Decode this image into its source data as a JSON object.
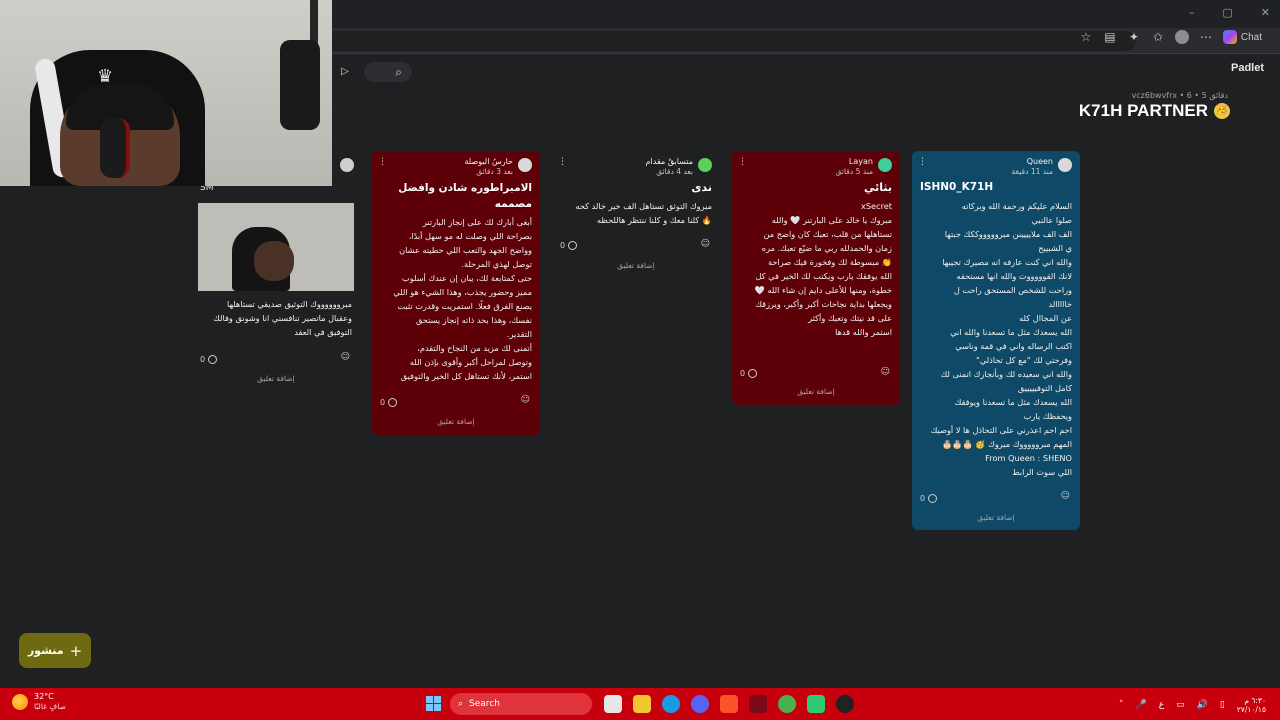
{
  "browser": {
    "window_controls": [
      "–",
      "▢",
      "✕"
    ],
    "chat_label": "Chat"
  },
  "padlet": {
    "logo": "Padlet",
    "board_meta": "vcz6bwvfrx • 6 • 5 دقائق",
    "board_title": "K71H PARTNER",
    "board_emoji": "🥳",
    "post_button_label": "منشور",
    "add_comment_label": "إضافة تعليق"
  },
  "cards": [
    {
      "id": "queen",
      "author": "Queen",
      "time": "منذ 11 دقيقة",
      "title": "ISHN0_K71H",
      "body": "السلام عليكم ورحمة الله وبركاته\nصلوا عالنبي\nالف الف ملايييينن مبروووووككك جبتها\nي الشبييح\nوالله اني كنت عارفه انه مصيرك تجيبها\nلانك القوووووت والله انها مستحقه\nوراحت للشخص المستحق راحت ل\nخااااالد\nعن المجاال كله\nالله يسعدك مثل ما تسعدنا والله اني\nاكتب الرساله واني في قمة وناسي\nوفرحتي لك \"مع كل تحاذلي\"\nوالله اني سعيده لك وبأنجازك اتمنى لك\nكامل التوفيييييق\nالله يسعدك مثل ما تسعدنا ويوفقك\nويحفظك يارب\nاحم احم اعذرني على التحاذل ها لا أوصيك\nالمهم مبروووووك مبروك 🥳 🎂🎂🎂\nFrom Queen : SHENO\nاللي سوت الرابط",
      "comments": "0",
      "color": "#0e4a67"
    },
    {
      "id": "layan",
      "author": "Layan",
      "time": "منذ 5 دقائق",
      "title": "بثائي",
      "body": "xSecret\nمبروك يا خالد على البارتنر 🤍 والله\nتستاهلها من قلب، تعبك كان واضح من\nزمان والحمدلله ربي ما ضيّع تعبك. مره\n👏 مبسوطة لك وفخورة فيك صراحة\nالله يوفقك يارب ويكتب لك الخير في كل\nخطوة، ومنها للأعلى دايم إن شاء الله 🤍\nويجعلها بداية نجاحات أكبر وأكبر، ويرزقك\nعلى قد نيتك وتعبك وأكثر\nاستمر والله قدها",
      "comments": "0",
      "color": "#5e0007"
    },
    {
      "id": "contestant",
      "author": "متسابقٌ مقدام",
      "time": "بعد 4 دقائق",
      "title": "ندى",
      "body": "مبروك التوثق تستاهل الف خير خالد كحه\n🔥 كلنا معك و كلنا ننتظر هاللحظه",
      "comments": "0",
      "color": "#1f2022"
    },
    {
      "id": "guardian",
      "author": "حارسُ البوصلة",
      "time": "بعد 3 دقائق",
      "title": "الامبراطوره شادن وافضل\nمصممه",
      "body": "أبغى أبارك لك على إنجاز البارتنر\nبصراحة اللي وصلت له مو سهل أبدًا،\nوواضح الجهد والتعب اللي حطيته عشان\nتوصل لهذي المرحلة.\nحتى كمتابعة لك، يبان إن عندك أسلوب\nمميز وحضور يجذب، وهذا الشيء هو اللي\nيصنع الفرق فعلًا. استمريت وقدرت تثبت\nنفسك، وهذا بحد ذاته إنجاز يستحق\nالتقدير.\nأتمنى لك مزيد من النجاح والتقدم،\nوتوصل لمراحل أكبر وأقوى بإذن الله\nاستمر، لأنك تستاهل كل الخير والتوفيق",
      "comments": "0",
      "color": "#5e0007"
    },
    {
      "id": "fifth",
      "author_snippet": "SM",
      "body": "مبرووووووك التوثيق صديقي تستاهلها\nوعقبال ماتصير تنافسني انا وشونق وفالك\nالتوفيق في العقد",
      "comments": "0",
      "color": "#1f2022"
    }
  ],
  "taskbar": {
    "weather_temp": "32°C",
    "weather_condition": "صافٍ غالبًا",
    "search_label": "Search",
    "clock_time": "٦:٣٠ م",
    "clock_date": "٢٧/١٠/١٥",
    "lang_indicator": "ع"
  },
  "accent_colors": {
    "card_red": "#5e0007",
    "card_blue": "#0e4a67",
    "post_button": "#6d6a10",
    "taskbar": "#c8000e"
  }
}
